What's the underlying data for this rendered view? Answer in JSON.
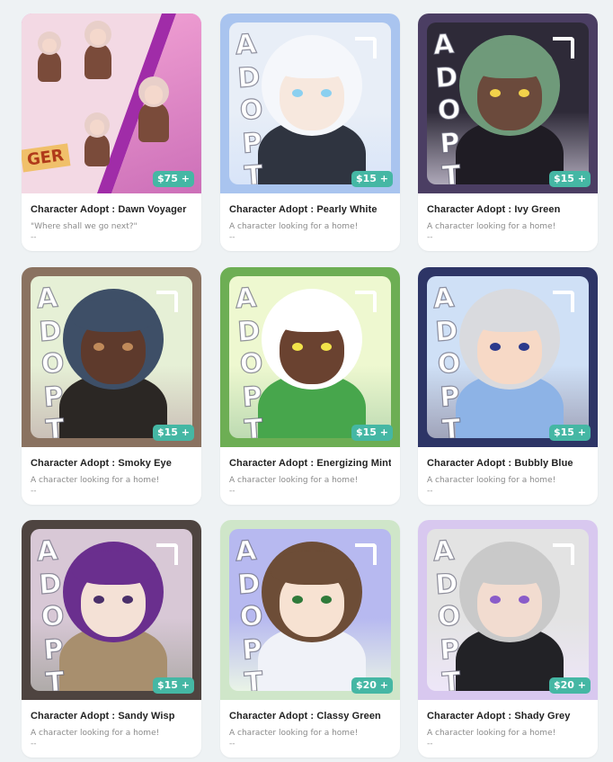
{
  "cards": [
    {
      "title": "Character Adopt : Dawn Voyager",
      "desc": "\"Where shall we go next?\"",
      "extra": "--",
      "price": "$75 +",
      "art": "dawn-voyager",
      "colors": {
        "border": "#d84fb5",
        "bg": "#f2c9e6",
        "hair": "#e8cfc9",
        "face": "#f4d8cc",
        "body": "#7a4b3a",
        "accent": "#a02ca8"
      },
      "banner_text": "GER"
    },
    {
      "title": "Character Adopt : Pearly White",
      "desc": "A character looking for a home!",
      "extra": "--",
      "price": "$15 +",
      "art": "adopt-portrait",
      "adopt_letters": [
        "A",
        "D",
        "O",
        "P",
        "T"
      ],
      "colors": {
        "border": "#a9c4ef",
        "bg": "#e8eef7",
        "hair": "#f5f7fb",
        "face": "#f7e8de",
        "body": "#2f3440",
        "accent": "#8bd0f0"
      }
    },
    {
      "title": "Character Adopt : Ivy Green",
      "desc": "A character looking for a home!",
      "extra": "--",
      "price": "$15 +",
      "art": "adopt-portrait",
      "adopt_letters": [
        "A",
        "D",
        "O",
        "P",
        "T"
      ],
      "colors": {
        "border": "#4b3e63",
        "bg": "#2e2a38",
        "hair": "#6f9a7a",
        "face": "#6b4a3c",
        "body": "#1f1c24",
        "accent": "#f2d24a"
      }
    },
    {
      "title": "Character Adopt : Smoky Eye",
      "desc": "A character looking for a home!",
      "extra": "--",
      "price": "$15 +",
      "art": "adopt-portrait",
      "adopt_letters": [
        "A",
        "D",
        "O",
        "P",
        "T"
      ],
      "colors": {
        "border": "#8a7260",
        "bg": "#e6f0d6",
        "hair": "#3e4f67",
        "face": "#5e3a2c",
        "body": "#2b2724",
        "accent": "#c08a5a"
      }
    },
    {
      "title": "Character Adopt : Energizing Mint",
      "desc": "A character looking for a home!",
      "extra": "--",
      "price": "$15 +",
      "art": "adopt-portrait",
      "adopt_letters": [
        "A",
        "D",
        "O",
        "P",
        "T"
      ],
      "colors": {
        "border": "#6dae54",
        "bg": "#eef8d0",
        "hair": "#ffffff",
        "face": "#6a4230",
        "body": "#47a64c",
        "accent": "#f2e34a"
      }
    },
    {
      "title": "Character Adopt : Bubbly Blue",
      "desc": "A character looking for a home!",
      "extra": "--",
      "price": "$15 +",
      "art": "adopt-portrait",
      "adopt_letters": [
        "A",
        "D",
        "O",
        "P",
        "T"
      ],
      "colors": {
        "border": "#2d3566",
        "bg": "#cfe0f6",
        "hair": "#d9dade",
        "face": "#f7d9c6",
        "body": "#8db3e6",
        "accent": "#2c3a8c"
      }
    },
    {
      "title": "Character Adopt : Sandy Wisp",
      "desc": "A character looking for a home!",
      "extra": "--",
      "price": "$15 +",
      "art": "adopt-portrait",
      "adopt_letters": [
        "A",
        "D",
        "O",
        "P",
        "T"
      ],
      "colors": {
        "border": "#4e4440",
        "bg": "#d8c8d6",
        "hair": "#6a2f8e",
        "face": "#f4e1d6",
        "body": "#a88f6e",
        "accent": "#4a2f6a"
      }
    },
    {
      "title": "Character Adopt : Classy Green",
      "desc": "A character looking for a home!",
      "extra": "--",
      "price": "$20 +",
      "art": "adopt-portrait",
      "adopt_letters": [
        "A",
        "D",
        "O",
        "P",
        "T"
      ],
      "colors": {
        "border": "#cfe6c9",
        "bg": "#b7b9f0",
        "hair": "#6d4d37",
        "face": "#f7e2d2",
        "body": "#f0f2f8",
        "accent": "#2f7a3a"
      }
    },
    {
      "title": "Character Adopt : Shady Grey",
      "desc": "A character looking for a home!",
      "extra": "--",
      "price": "$20 +",
      "art": "adopt-portrait",
      "adopt_letters": [
        "A",
        "D",
        "O",
        "P",
        "T"
      ],
      "colors": {
        "border": "#d8c8ef",
        "bg": "#e3e3e3",
        "hair": "#c9c9c9",
        "face": "#f2dcd0",
        "body": "#222226",
        "accent": "#8a5cc9"
      }
    }
  ]
}
